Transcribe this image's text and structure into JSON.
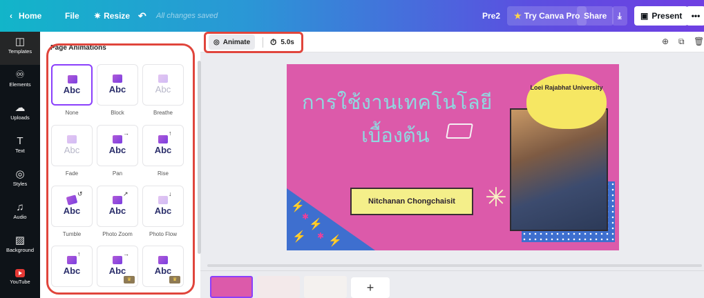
{
  "topbar": {
    "home": "Home",
    "file": "File",
    "resize": "Resize",
    "saved": "All changes saved",
    "doc_name": "Pre2",
    "try_pro": "Try Canva Pro",
    "share": "Share",
    "present": "Present"
  },
  "nav": [
    {
      "label": "Templates",
      "icon": "templates-icon",
      "glyph": "◫"
    },
    {
      "label": "Elements",
      "icon": "elements-icon",
      "glyph": "♾"
    },
    {
      "label": "Uploads",
      "icon": "uploads-icon",
      "glyph": "☁"
    },
    {
      "label": "Text",
      "icon": "text-icon",
      "glyph": "T"
    },
    {
      "label": "Styles",
      "icon": "styles-icon",
      "glyph": "◎"
    },
    {
      "label": "Audio",
      "icon": "audio-icon",
      "glyph": "♫"
    },
    {
      "label": "Background",
      "icon": "background-icon",
      "glyph": "▨"
    },
    {
      "label": "YouTube",
      "icon": "youtube-icon",
      "glyph": ""
    }
  ],
  "panel": {
    "title": "Page Animations",
    "animations": [
      {
        "label": "None",
        "abc": "Abc"
      },
      {
        "label": "Block",
        "abc": "Abc"
      },
      {
        "label": "Breathe",
        "abc": "Abc"
      },
      {
        "label": "Fade",
        "abc": "Abc"
      },
      {
        "label": "Pan",
        "abc": "Abc"
      },
      {
        "label": "Rise",
        "abc": "Abc"
      },
      {
        "label": "Tumble",
        "abc": "Abc"
      },
      {
        "label": "Photo Zoom",
        "abc": "Abc"
      },
      {
        "label": "Photo Flow",
        "abc": "Abc"
      },
      {
        "label": "",
        "abc": "Abc"
      },
      {
        "label": "",
        "abc": "Abc"
      },
      {
        "label": "",
        "abc": "Abc"
      }
    ]
  },
  "toolbar": {
    "animate": "Animate",
    "duration": "5.0s"
  },
  "slide": {
    "title_line1": "การใช้งานเทคโนโลยี",
    "title_line2": "เบื้องต้น",
    "author": "Nitchanan Chongchaisit",
    "university": "Loei Rajabhat University",
    "bg_color": "#dc5aaa",
    "title_color": "#8fd9e0",
    "banner_color": "#f4ef8a",
    "cloud_color": "#f6e763"
  },
  "bottom": {
    "add_page": "+"
  },
  "colors": {
    "accent": "#8a3ffc",
    "highlight_box": "#e0453c"
  }
}
